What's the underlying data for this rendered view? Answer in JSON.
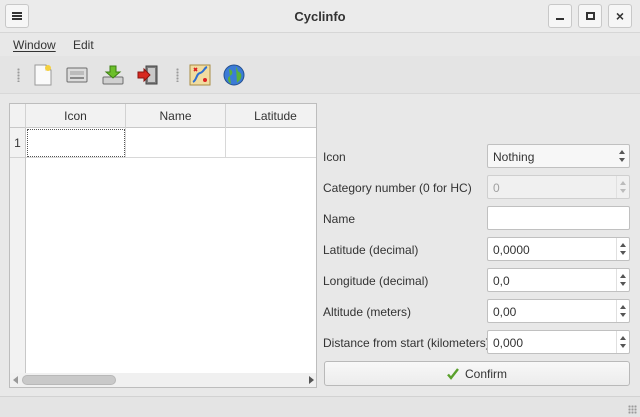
{
  "window": {
    "title": "Cyclinfo"
  },
  "menu": {
    "items": [
      "Window",
      "Edit"
    ]
  },
  "toolbar": {
    "icons": [
      "new-document-icon",
      "open-icon",
      "import-icon",
      "exit-icon",
      "route-map-icon",
      "globe-icon"
    ]
  },
  "table": {
    "columns": [
      "Icon",
      "Name",
      "Latitude"
    ],
    "rows": [
      {
        "number": "1",
        "cells": [
          "",
          "",
          ""
        ]
      }
    ]
  },
  "form": {
    "icon_label": "Icon",
    "icon_value": "Nothing",
    "category_label": "Category number (0 for HC)",
    "category_value": "0",
    "name_label": "Name",
    "name_value": "",
    "latitude_label": "Latitude (decimal)",
    "latitude_value": "0,0000",
    "longitude_label": "Longitude (decimal)",
    "longitude_value": "0,0",
    "altitude_label": "Altitude (meters)",
    "altitude_value": "0,00",
    "distance_label": "Distance from start (kilometers)",
    "distance_value": "0,000",
    "confirm_label": "Confirm"
  },
  "colors": {
    "window_bg": "#e8e8e8",
    "confirm_check": "#5aa02c"
  }
}
